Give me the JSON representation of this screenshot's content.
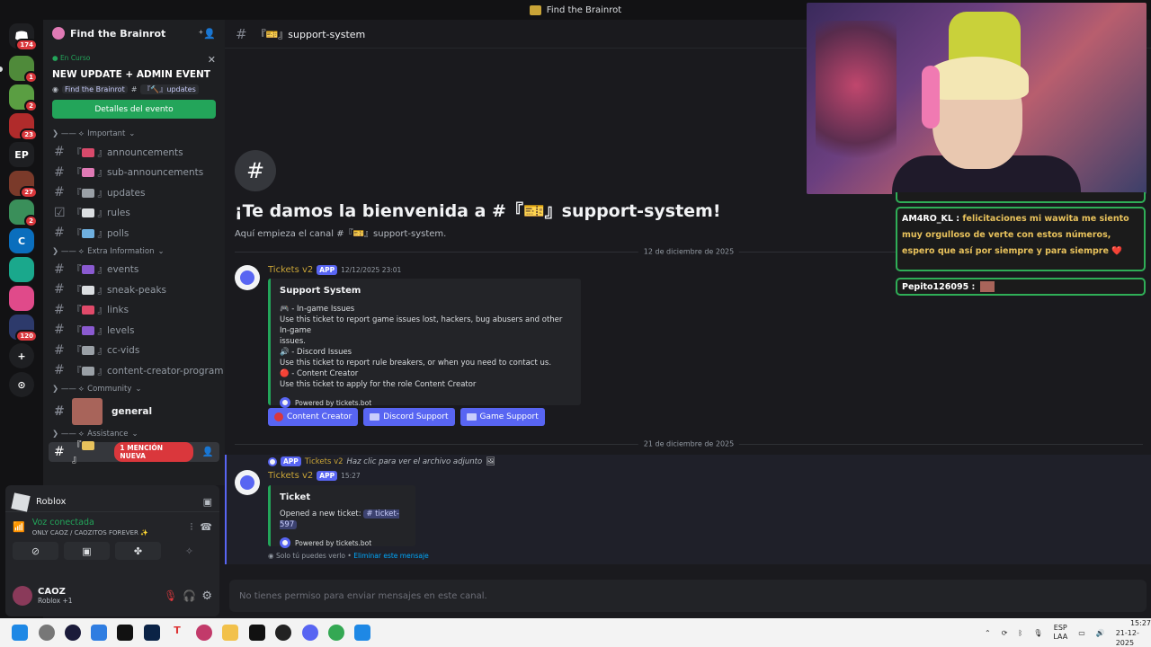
{
  "titlebar": {
    "title": "Find the Brainrot"
  },
  "rail": {
    "badges": [
      "174",
      "1",
      "2",
      "23",
      "27",
      "2",
      "120"
    ],
    "ep_label": "EP"
  },
  "sidebar": {
    "server_name": "Find the Brainrot",
    "event": {
      "status": "En Curso",
      "title": "NEW UPDATE + ADMIN EVENT",
      "server": "Find the Brainrot",
      "channel": "『🔨』updates",
      "button": "Detalles del evento"
    },
    "categories": {
      "important": "Important",
      "extra": "Extra Information",
      "community": "Community",
      "assistance": "Assistance"
    },
    "channels": {
      "announcements": "announcements",
      "sub_announcements": "sub-announcements",
      "updates": "updates",
      "rules": "rules",
      "polls": "polls",
      "events": "events",
      "sneak_peaks": "sneak-peaks",
      "links": "links",
      "levels": "levels",
      "cc_vids": "cc-vids",
      "content_creator_program": "content-creator-program",
      "general": "general"
    },
    "mention_badge": "1 MENCIÓN NUEVA"
  },
  "voice": {
    "activity": "Roblox",
    "status": "Voz conectada",
    "channel": "ONLY CAOZ / CAOZITOS FOREVER ✨"
  },
  "user": {
    "name": "CAOZ",
    "status": "Roblox +1"
  },
  "main": {
    "channel": "『🎫』support-system",
    "welcome_title": "¡Te damos la bienvenida a #『🎫』support-system!",
    "welcome_sub": "Aquí empieza el canal #『🎫』support-system.",
    "date1": "12 de diciembre de 2025",
    "date2": "21 de diciembre de 2025",
    "msg1": {
      "author": "Tickets v2",
      "tag": "APP",
      "time": "12/12/2025 23:01",
      "embed_title": "Support System",
      "lines": [
        "🎮 - In-game Issues",
        "Use this ticket to report game issues lost, hackers, bug abusers and other In-game",
        "issues.",
        "🔊 - Discord Issues",
        "Use this ticket to report rule breakers, or when you need to contact us.",
        "🔴 - Content Creator",
        "Use this ticket to apply for the role Content Creator"
      ],
      "footer": "Powered by tickets.bot",
      "buttons": [
        "Content Creator",
        "Discord Support",
        "Game Support"
      ]
    },
    "reply": {
      "tag": "APP",
      "author": "Tickets v2",
      "text": "Haz clic para ver el archivo adjunto"
    },
    "msg2": {
      "author": "Tickets v2",
      "tag": "APP",
      "time": "15:27",
      "embed_title": "Ticket",
      "body": "Opened a new ticket:",
      "ticket": "# ticket-597",
      "footer": "Powered by tickets.bot",
      "ephemeral": "Solo tú puedes verlo •",
      "dismiss": "Eliminar este mensaje"
    },
    "input_placeholder": "No tienes permiso para enviar mensajes en este canal."
  },
  "chat": {
    "msg_user": "AM4RO_KL :",
    "msg_text": "felicitaciones mi wawita me siento muy orgulloso de verte con estos números, espero que así por siempre y para siempre ❤️",
    "msg2_user": "Pepito126095 :"
  },
  "taskbar": {
    "lang1": "ESP",
    "lang2": "LAA",
    "time": "15:27",
    "date": "21-12-2025"
  }
}
